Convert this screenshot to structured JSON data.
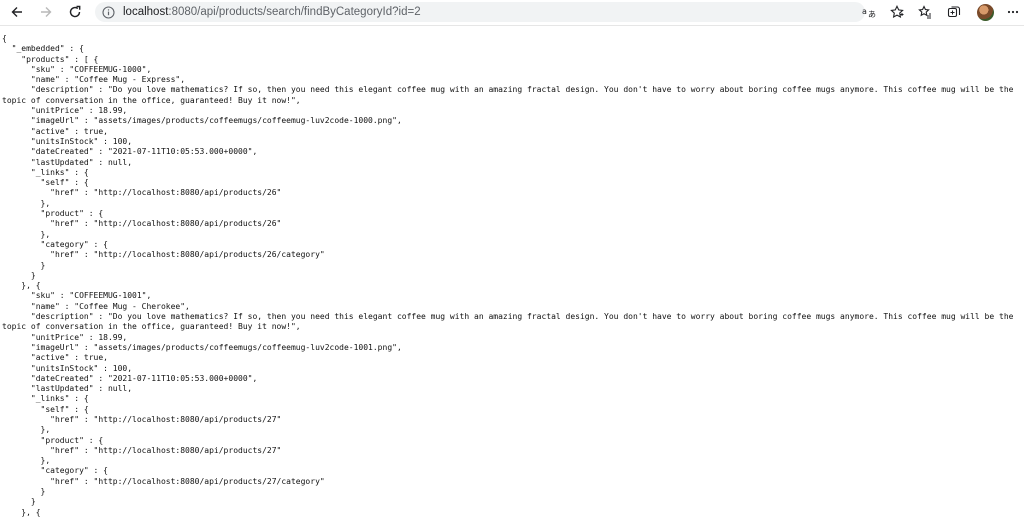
{
  "browser": {
    "url_host": "localhost",
    "url_rest": ":8080/api/products/search/findByCategoryId?id=2",
    "icons": {
      "back": "back-arrow-icon",
      "forward": "forward-arrow-icon",
      "reload": "reload-icon",
      "info": "info-icon",
      "read_aloud": "read-aloud-icon",
      "favorite": "star-icon",
      "favorites_bar": "favorites-icon",
      "collections": "collections-icon",
      "profile": "avatar",
      "menu": "more-icon"
    }
  },
  "json_lines": [
    "{",
    "  \"_embedded\" : {",
    "    \"products\" : [ {",
    "      \"sku\" : \"COFFEEMUG-1000\",",
    "      \"name\" : \"Coffee Mug - Express\",",
    "      \"description\" : \"Do you love mathematics? If so, then you need this elegant coffee mug with an amazing fractal design. You don't have to worry about boring coffee mugs anymore. This coffee mug will be the",
    "topic of conversation in the office, guaranteed! Buy it now!\",",
    "      \"unitPrice\" : 18.99,",
    "      \"imageUrl\" : \"assets/images/products/coffeemugs/coffeemug-luv2code-1000.png\",",
    "      \"active\" : true,",
    "      \"unitsInStock\" : 100,",
    "      \"dateCreated\" : \"2021-07-11T10:05:53.000+0000\",",
    "      \"lastUpdated\" : null,",
    "      \"_links\" : {",
    "        \"self\" : {",
    "          \"href\" : \"http://localhost:8080/api/products/26\"",
    "        },",
    "        \"product\" : {",
    "          \"href\" : \"http://localhost:8080/api/products/26\"",
    "        },",
    "        \"category\" : {",
    "          \"href\" : \"http://localhost:8080/api/products/26/category\"",
    "        }",
    "      }",
    "    }, {",
    "      \"sku\" : \"COFFEEMUG-1001\",",
    "      \"name\" : \"Coffee Mug - Cherokee\",",
    "      \"description\" : \"Do you love mathematics? If so, then you need this elegant coffee mug with an amazing fractal design. You don't have to worry about boring coffee mugs anymore. This coffee mug will be the",
    "topic of conversation in the office, guaranteed! Buy it now!\",",
    "      \"unitPrice\" : 18.99,",
    "      \"imageUrl\" : \"assets/images/products/coffeemugs/coffeemug-luv2code-1001.png\",",
    "      \"active\" : true,",
    "      \"unitsInStock\" : 100,",
    "      \"dateCreated\" : \"2021-07-11T10:05:53.000+0000\",",
    "      \"lastUpdated\" : null,",
    "      \"_links\" : {",
    "        \"self\" : {",
    "          \"href\" : \"http://localhost:8080/api/products/27\"",
    "        },",
    "        \"product\" : {",
    "          \"href\" : \"http://localhost:8080/api/products/27\"",
    "        },",
    "        \"category\" : {",
    "          \"href\" : \"http://localhost:8080/api/products/27/category\"",
    "        }",
    "      }",
    "    }, {"
  ]
}
